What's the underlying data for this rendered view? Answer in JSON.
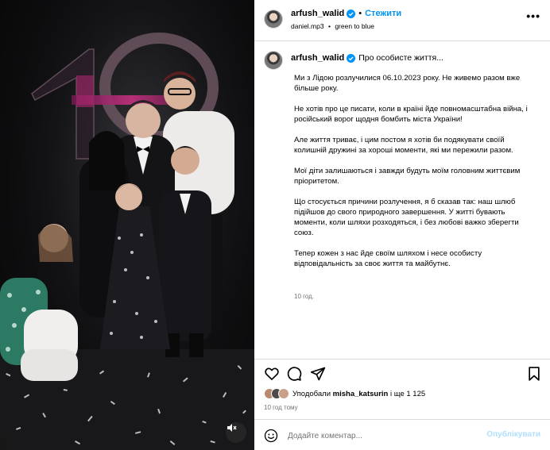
{
  "post": {
    "author": "arfush_walid",
    "follow_label": "Стежити",
    "separator": "•",
    "audio_track": "daniel.mp3",
    "audio_artist": "green to blue",
    "more_label": "•••"
  },
  "caption": {
    "author": "arfush_walid",
    "title": "Про особисте життя...",
    "paragraphs": [
      "Ми з Лідою розлучилися 06.10.2023 року. Не живемо разом вже більше року.",
      "Не хотів про це писати, коли в країні йде повномасштабна війна, і російський ворог щодня бомбить міста України!",
      "Але життя триває, і цим постом я хотів би подякувати своїй колишній дружині за хороші моменти, які ми пережили разом.",
      "Мої діти залишаються і завжди будуть моїм головним життєвим пріоритетом.",
      "Що стосується причини розлучення, я б сказав так: наш шлюб підійшов до свого природного завершення. У житті бувають моменти, коли шляхи розходяться, і без любові важко зберегти союз.",
      "Тепер кожен з нас йде своїм шляхом і несе особисту відповідальність за своє життя та майбутнє."
    ],
    "time": "10 год."
  },
  "actions": {
    "like_icon": "heart-icon",
    "comment_icon": "comment-icon",
    "share_icon": "send-icon",
    "save_icon": "bookmark-icon"
  },
  "likes": {
    "prefix": "Уподобали",
    "user": "misha_katsurin",
    "suffix": "і ще 1 125"
  },
  "post_time": "10 год тому",
  "comment": {
    "emoji_icon": "emoji-icon",
    "placeholder": "Додайте коментар...",
    "publish_label": "Опублікувати"
  },
  "photo": {
    "backdrop_number": "10",
    "audio_icon": "speaker-muted-icon"
  },
  "colors": {
    "accent": "#0095f6",
    "publish_disabled": "#b2dffc",
    "muted_text": "#737373",
    "border": "#dbdbdb"
  }
}
